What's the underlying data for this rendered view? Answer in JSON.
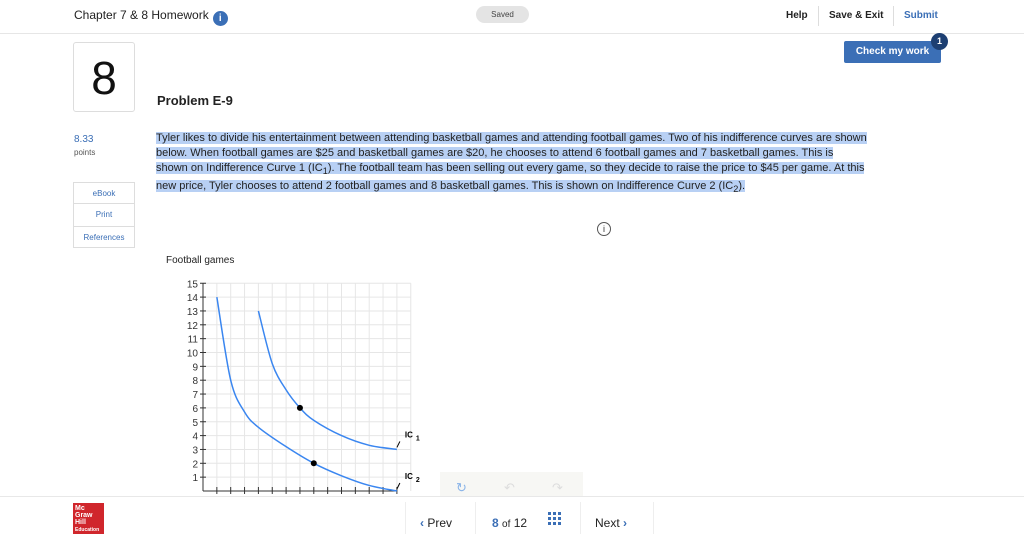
{
  "header": {
    "title": "Chapter 7 & 8 Homework",
    "info_icon": "info-icon",
    "saved": "Saved",
    "help": "Help",
    "save_exit": "Save & Exit",
    "submit": "Submit"
  },
  "check": {
    "label": "Check my work",
    "badge": "1"
  },
  "question": {
    "number": "8",
    "title": "Problem E-9",
    "points": "8.33",
    "points_label": "points",
    "text_parts": [
      "Tyler likes to divide his entertainment between attending basketball games and attending football games. Two of his indifference curves are shown below. When football games are $25 and basketball games are $20, he chooses to attend 6 football games and 7 basketball games. This is shown on Indifference Curve 1 (IC",
      "1",
      "). The football team has been selling out every game, so they decide to raise the price to $45 per game. At this new price, Tyler chooses to attend 2 football games and 8 basketball games. This is shown on Indifference Curve 2 (IC",
      "2",
      ")."
    ]
  },
  "sidebar": [
    "eBook",
    "Print",
    "References"
  ],
  "chart_data": {
    "type": "line",
    "ylabel": "Football games",
    "ylim": [
      0,
      15
    ],
    "xlim": [
      0,
      15
    ],
    "yticks": [
      "15",
      "14",
      "13",
      "12",
      "11",
      "10",
      "9",
      "8",
      "7",
      "6",
      "5",
      "4",
      "3",
      "2",
      "1"
    ],
    "grid": true,
    "color": "#3a86f0",
    "series": [
      {
        "name": "IC 1",
        "label": "IC",
        "sub": "1",
        "points": [
          [
            4,
            13
          ],
          [
            5,
            9.2
          ],
          [
            6,
            7.3
          ],
          [
            7,
            6
          ],
          [
            8,
            5.1
          ],
          [
            10,
            4
          ],
          [
            12,
            3.3
          ],
          [
            14,
            3
          ]
        ],
        "marker": [
          7,
          6
        ]
      },
      {
        "name": "IC 2",
        "label": "IC",
        "sub": "2",
        "points": [
          [
            1,
            14
          ],
          [
            2,
            8
          ],
          [
            3,
            5.7
          ],
          [
            4,
            4.6
          ],
          [
            6,
            3.2
          ],
          [
            8,
            2
          ],
          [
            10,
            1.1
          ],
          [
            12,
            0.4
          ],
          [
            14,
            0
          ]
        ],
        "marker": [
          8,
          2
        ]
      }
    ]
  },
  "footer": {
    "logo": "Mc Graw Hill Education",
    "prev": "Prev",
    "current": "8",
    "of": "of",
    "total": "12",
    "next": "Next"
  }
}
